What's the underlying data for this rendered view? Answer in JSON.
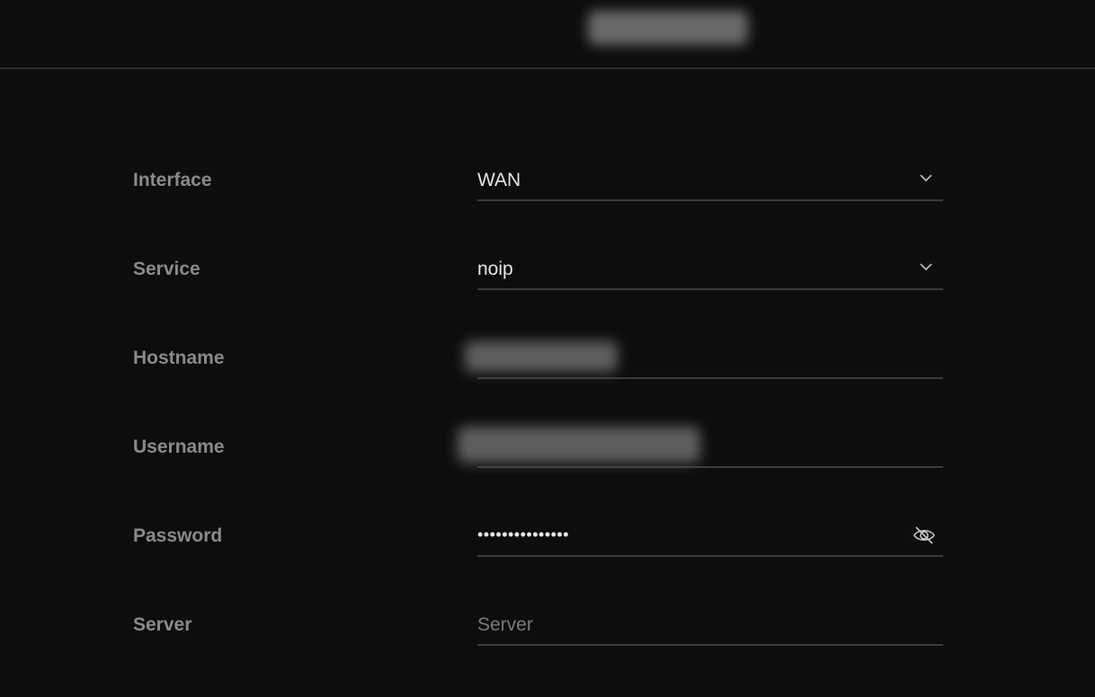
{
  "form": {
    "interface": {
      "label": "Interface",
      "value": "WAN",
      "icon": "chevron-down-icon"
    },
    "service": {
      "label": "Service",
      "value": "noip",
      "icon": "chevron-down-icon"
    },
    "hostname": {
      "label": "Hostname"
    },
    "username": {
      "label": "Username"
    },
    "password": {
      "label": "Password",
      "masked_value": "•••••••••••••••",
      "icon": "eye-off-icon"
    },
    "server": {
      "label": "Server",
      "placeholder": "Server"
    }
  },
  "colors": {
    "background": "#0d0d0d",
    "label": "#8a8a8a",
    "value": "#e6e6e6",
    "underline": "#3b3b3b"
  }
}
